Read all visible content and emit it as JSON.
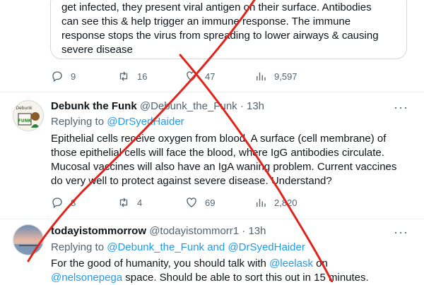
{
  "quoted_tweet": {
    "lines": [
      "get infected, they present viral antigen on their surface. Antibodies",
      "can see this & help trigger an immune response. The immune",
      "response stops the virus from spreading to lower airways & causing",
      "severe disease"
    ],
    "replies": "9",
    "retweets": "16",
    "likes": "47",
    "views": "9,597"
  },
  "tweet1": {
    "name": "Debunk the Funk",
    "handle_time": "@Debunk_the_Funk · 13h",
    "replying_prefix": "Replying to ",
    "replying_to": "@DrSyedHaider",
    "avatar_text": "Debunk the FUNK",
    "lines": [
      "Epithelial cells receive oxygen from blood. A surface (cell membrane) of",
      "those epithelial cells will face the blood, where IgG antibodies circulate.",
      "Mucosal vaccines will also have an IgA waning problem. Current vaccines",
      "do very well to protect against severe disease. Understand?"
    ],
    "replies": "8",
    "retweets": "4",
    "likes": "69",
    "views": "2,820",
    "more_label": "···"
  },
  "tweet2": {
    "name": "todayistommorrow",
    "handle_time": "@todayistommorr1 · 13h",
    "replying_prefix": "Replying to ",
    "replying_to": "@Debunk_the_Funk and @DrSyedHaider",
    "line1_prefix": "For the good of humanity, you should talk with ",
    "line1_mention": "@leelask",
    "line1_suffix": " on",
    "line2_mention": "@nelsonepega",
    "line2_suffix": "  space. Should be able to sort this out in 15 minutes.",
    "more_label": "···"
  },
  "colors": {
    "accent": "#1d9bf0",
    "muted": "#536471",
    "cross": "#e0241b"
  }
}
